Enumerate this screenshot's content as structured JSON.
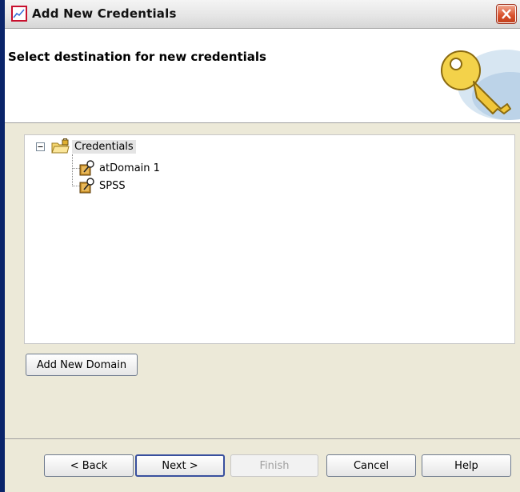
{
  "window": {
    "title": "Add New Credentials"
  },
  "header": {
    "title": "Select destination for new credentials"
  },
  "tree": {
    "root": {
      "label": "Credentials",
      "icon": "folder-lock-icon",
      "expanded": true
    },
    "children": [
      {
        "label": "atDomain 1",
        "icon": "domain-key-icon"
      },
      {
        "label": "SPSS",
        "icon": "domain-key-icon"
      }
    ]
  },
  "buttons": {
    "add_domain": "Add New Domain",
    "back": "< Back",
    "next": "Next >",
    "finish": "Finish",
    "cancel": "Cancel",
    "help": "Help"
  },
  "colors": {
    "window_bg": "#ece9d8",
    "close_button": "#d8502c",
    "border_accent": "#0a246a"
  }
}
